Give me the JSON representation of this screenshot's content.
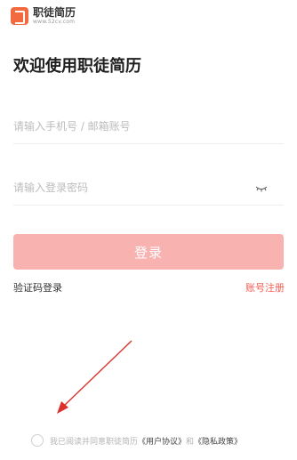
{
  "brand": {
    "name": "职徒简历",
    "url": "www.52cv.com"
  },
  "welcome_title": "欢迎使用职徒简历",
  "form": {
    "phone_placeholder": "请输入手机号 / 邮箱账号",
    "password_placeholder": "请输入登录密码",
    "login_label": "登录"
  },
  "links": {
    "sms_login": "验证码登录",
    "register": "账号注册"
  },
  "agreement": {
    "prefix": "我已阅读并同意职徒简历",
    "user_agreement": "《用户协议》",
    "and": "和",
    "privacy_policy": "《隐私政策》",
    "checked": false
  },
  "colors": {
    "brand": "#f26a3d",
    "login_button": "#f8b3b0",
    "register_link": "#f45a4f",
    "annotation_arrow": "#d9322b"
  },
  "icons": {
    "password_toggle": "eye-closed-icon"
  }
}
